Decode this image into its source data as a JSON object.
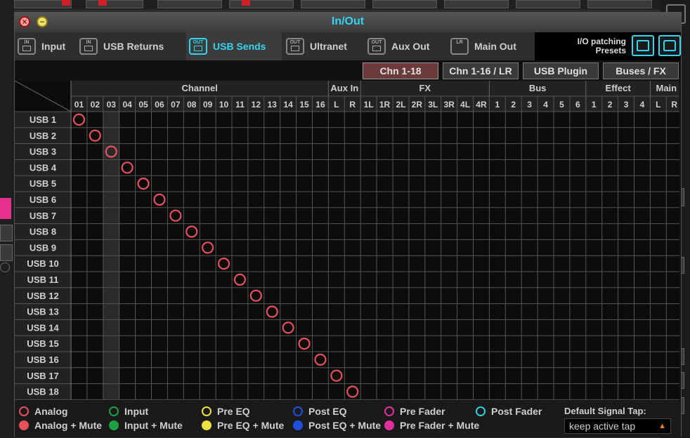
{
  "window": {
    "title": "In/Out"
  },
  "tabs": [
    {
      "label": "Input",
      "icon_text": "IN"
    },
    {
      "label": "USB Returns",
      "icon_text": "IN"
    },
    {
      "label": "USB Sends",
      "icon_text": "OUT",
      "active": true
    },
    {
      "label": "Ultranet",
      "icon_text": "OUT"
    },
    {
      "label": "Aux Out",
      "icon_text": "OUT"
    },
    {
      "label": "Main Out",
      "icon_text": "LR"
    }
  ],
  "presets": {
    "label_line1": "I/O patching",
    "label_line2": "Presets",
    "save_icon": "save-icon",
    "open_icon": "folder-icon"
  },
  "range_buttons": [
    {
      "label": "Chn 1-18",
      "active": true
    },
    {
      "label": "Chn 1-16 / LR"
    },
    {
      "label": "USB Plugin"
    },
    {
      "label": "Buses / FX"
    }
  ],
  "matrix": {
    "groups": [
      {
        "label": "Channel",
        "span": 16
      },
      {
        "label": "Aux In",
        "span": 2
      },
      {
        "label": "FX",
        "span": 8
      },
      {
        "label": "Bus",
        "span": 6
      },
      {
        "label": "Effect",
        "span": 4
      },
      {
        "label": "Main",
        "span": 2
      }
    ],
    "columns": [
      "01",
      "02",
      "03",
      "04",
      "05",
      "06",
      "07",
      "08",
      "09",
      "10",
      "11",
      "12",
      "13",
      "14",
      "15",
      "16",
      "L",
      "R",
      "1L",
      "1R",
      "2L",
      "2R",
      "3L",
      "3R",
      "4L",
      "4R",
      "1",
      "2",
      "3",
      "4",
      "5",
      "6",
      "1",
      "2",
      "3",
      "4",
      "L",
      "R"
    ],
    "rows": [
      "USB 1",
      "USB 2",
      "USB 3",
      "USB 4",
      "USB 5",
      "USB 6",
      "USB 7",
      "USB 8",
      "USB 9",
      "USB 10",
      "USB 11",
      "USB 12",
      "USB 13",
      "USB 14",
      "USB 15",
      "USB 16",
      "USB 17",
      "USB 18"
    ],
    "patches": [
      [
        0,
        0
      ],
      [
        1,
        1
      ],
      [
        2,
        2
      ],
      [
        3,
        3
      ],
      [
        4,
        4
      ],
      [
        5,
        5
      ],
      [
        6,
        6
      ],
      [
        7,
        7
      ],
      [
        8,
        8
      ],
      [
        9,
        9
      ],
      [
        10,
        10
      ],
      [
        11,
        11
      ],
      [
        12,
        12
      ],
      [
        13,
        13
      ],
      [
        14,
        14
      ],
      [
        15,
        15
      ],
      [
        16,
        16
      ],
      [
        17,
        17
      ]
    ],
    "highlight_column": 2,
    "patch_color": "#e8505a"
  },
  "legend": [
    {
      "label": "Analog",
      "color": "#e8505a",
      "filled": false
    },
    {
      "label": "Input",
      "color": "#1fa040",
      "filled": false
    },
    {
      "label": "Pre EQ",
      "color": "#f0e040",
      "filled": false
    },
    {
      "label": "Post EQ",
      "color": "#2050e0",
      "filled": false
    },
    {
      "label": "Pre Fader",
      "color": "#e030a0",
      "filled": false
    },
    {
      "label": "Post Fader",
      "color": "#30d0e0",
      "filled": false
    },
    {
      "label": "Analog + Mute",
      "color": "#e8505a",
      "filled": true
    },
    {
      "label": "Input + Mute",
      "color": "#1fa040",
      "filled": true
    },
    {
      "label": "Pre EQ + Mute",
      "color": "#f0e040",
      "filled": true
    },
    {
      "label": "Post EQ + Mute",
      "color": "#2050e0",
      "filled": true
    },
    {
      "label": "Pre Fader + Mute",
      "color": "#e030a0",
      "filled": true
    }
  ],
  "signal_tap": {
    "label": "Default Signal Tap:",
    "value": "keep active tap"
  }
}
